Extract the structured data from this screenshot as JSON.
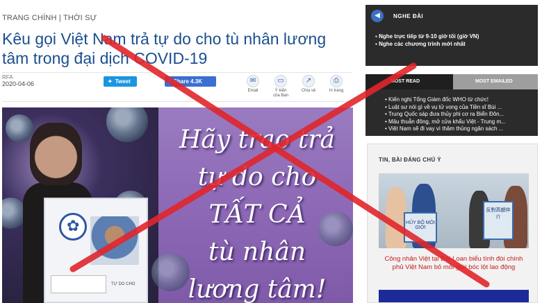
{
  "article": {
    "breadcrumb": "TRANG CHÍNH | THỜI SỰ",
    "title": "Kêu gọi Việt Nam trả tự do cho tù nhân lương tâm trong đại dịch COVID-19",
    "source": "RFA",
    "date": "2020-04-06",
    "share": {
      "tweet_label": "Tweet",
      "facebook_label": "Share 4.3K"
    },
    "actions": [
      {
        "label": "Email",
        "icon": "mail-icon"
      },
      {
        "label": "Ý kiến của Bạn",
        "icon": "comment-icon"
      },
      {
        "label": "Chia sẻ",
        "icon": "share-icon"
      },
      {
        "label": "In trang",
        "icon": "print-icon"
      }
    ],
    "hero_image": {
      "headline_lines": [
        "Hãy trao trả",
        "tự do cho",
        "TẤT CẢ",
        "tù nhân",
        "lương tâm!"
      ],
      "placard_caption": "TỰ DO CHO"
    }
  },
  "sidebar": {
    "nghe_dai": {
      "title": "NGHE ĐÀI",
      "icon": "speaker-icon",
      "items": [
        "Nghe trực tiếp từ 9-10 giờ tối (giờ VN)",
        "Nghe các chương trình mới nhất"
      ]
    },
    "tabs": [
      {
        "label": "MOST READ",
        "active": true
      },
      {
        "label": "MOST EMAILED",
        "active": false
      }
    ],
    "most_read": [
      "Kiến nghị Tổng Giám đốc WHO từ chức!",
      "Luật sư nói gì về vụ tử vong của Tiền sĩ Bùi ...",
      "Trung Quốc sáp đưa thủy phi cơ ra Biển Đôn...",
      "Mâu thuẫn đông, mở cửa khẩu Việt - Trung m...",
      "Việt Nam sẽ đi vay vì thâm thủng ngân sách ..."
    ],
    "featured": {
      "title": "TIN, BÀI ĐÁNG CHÚ Ý",
      "photo_signs": [
        "HỦY BỎ MÔI GIỚI",
        "反對高額仲介"
      ],
      "caption": "Công nhân Việt tại Đài Loan biểu tình đòi chính phủ Việt Nam bỏ môi giới bóc lột lao động"
    }
  },
  "overlay": {
    "x_color": "#e0262b"
  }
}
